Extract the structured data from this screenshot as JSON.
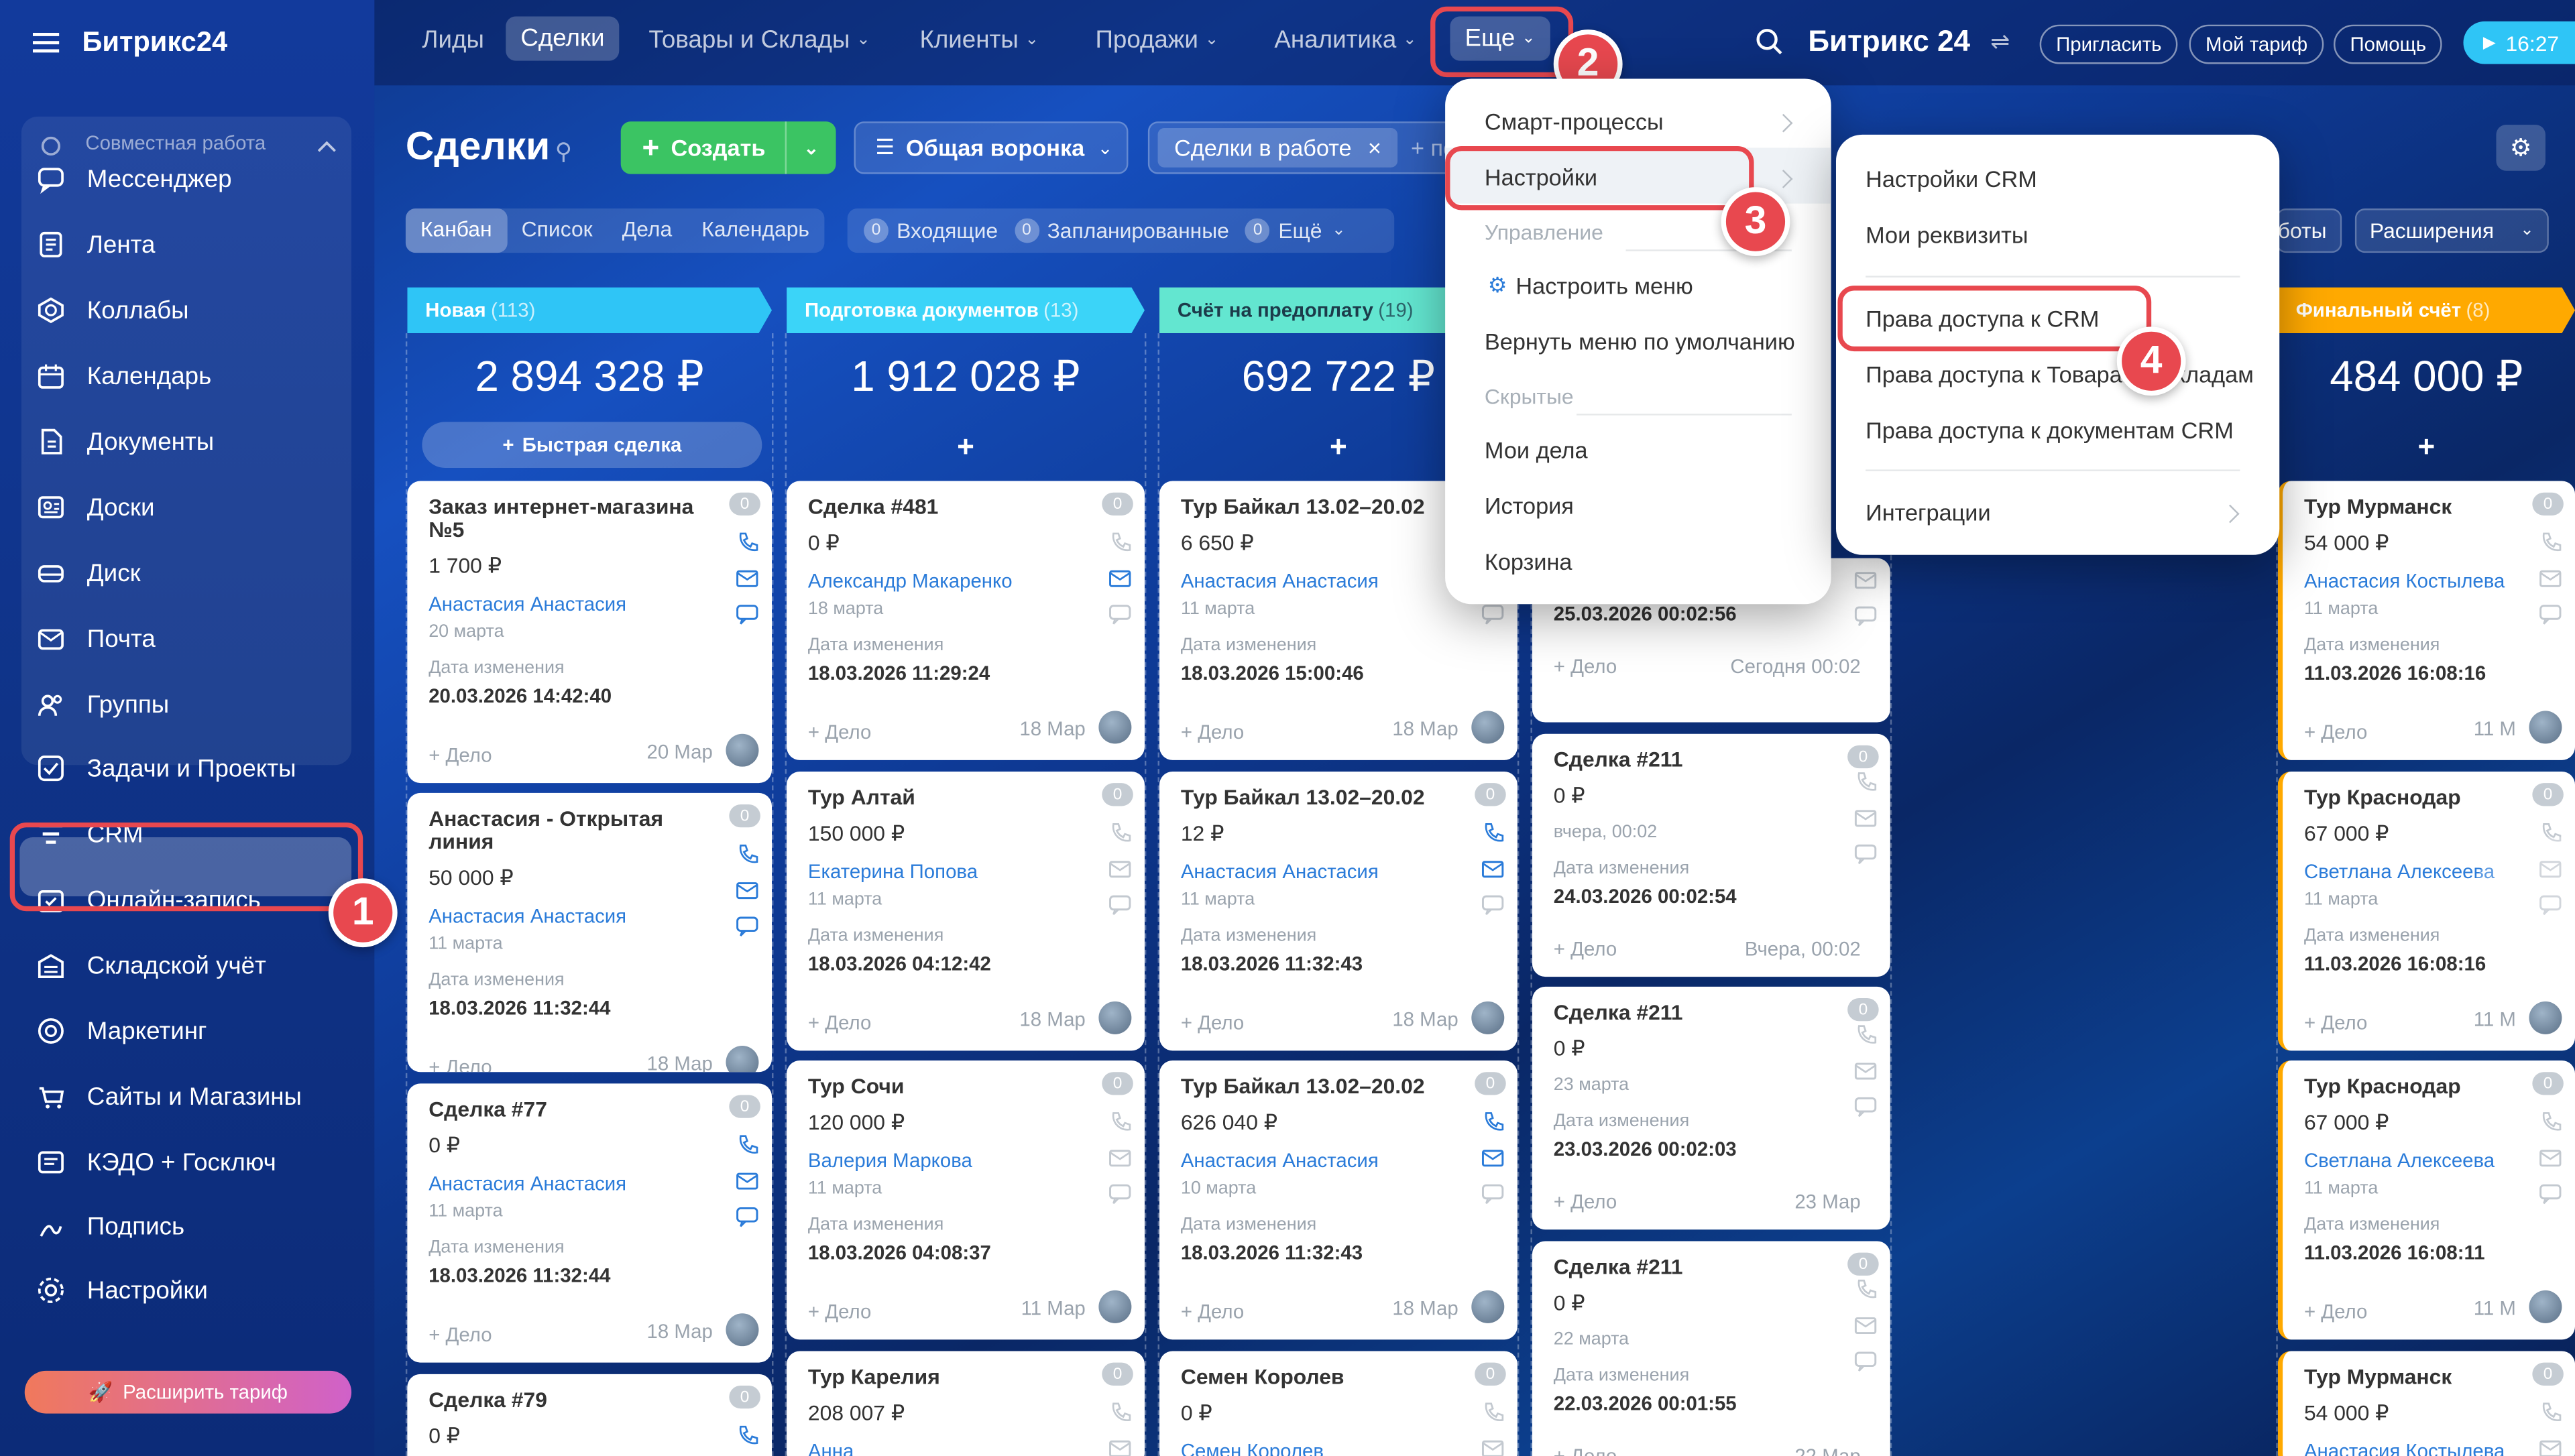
{
  "app": {
    "logo": "Битрикс24",
    "logo_right": "Битрикс 24",
    "time": "16:27"
  },
  "sidebar": {
    "group_title": "Совместная работа",
    "items": [
      {
        "label": "Мессенджер",
        "icon": "messenger-icon"
      },
      {
        "label": "Лента",
        "icon": "feed-icon"
      },
      {
        "label": "Коллабы",
        "icon": "collabs-icon"
      },
      {
        "label": "Календарь",
        "icon": "calendar-icon"
      },
      {
        "label": "Документы",
        "icon": "documents-icon"
      },
      {
        "label": "Доски",
        "icon": "boards-icon"
      },
      {
        "label": "Диск",
        "icon": "disk-icon"
      },
      {
        "label": "Почта",
        "icon": "mail-icon"
      },
      {
        "label": "Группы",
        "icon": "groups-icon"
      },
      {
        "label": "Задачи и Проекты",
        "icon": "tasks-icon"
      },
      {
        "label": "CRM",
        "icon": "crm-icon"
      },
      {
        "label": "Онлайн-запись",
        "icon": "booking-icon"
      },
      {
        "label": "Складской учёт",
        "icon": "warehouse-icon"
      },
      {
        "label": "Маркетинг",
        "icon": "marketing-icon"
      },
      {
        "label": "Сайты и Магазины",
        "icon": "sites-icon"
      },
      {
        "label": "КЭДО + Госключ",
        "icon": "kedo-icon"
      },
      {
        "label": "Подпись",
        "icon": "sign-icon"
      },
      {
        "label": "Настройки",
        "icon": "settings-icon"
      }
    ],
    "expand": "Расширить тариф"
  },
  "topnav": {
    "items": [
      "Лиды",
      "Сделки",
      "Товары и Склады",
      "Клиенты",
      "Продажи",
      "Аналитика",
      "Еще"
    ],
    "invite": "Пригласить",
    "tariff": "Мой тариф",
    "help": "Помощь"
  },
  "toolbar": {
    "title": "Сделки",
    "create": "Создать",
    "funnel": "Общая воронка",
    "filter_tag": "Сделки в работе",
    "filter_more": "+ по"
  },
  "views": [
    "Канбан",
    "Список",
    "Дела",
    "Календарь"
  ],
  "counters": [
    {
      "n": "0",
      "label": "Входящие"
    },
    {
      "n": "0",
      "label": "Запланированные"
    },
    {
      "n": "0",
      "label": "Ещё"
    }
  ],
  "right_buttons": {
    "partial": "боты",
    "extensions": "Расширения"
  },
  "stages": [
    {
      "name": "Новая",
      "count": "(113)",
      "sum": "2 894 328 ₽",
      "color": "#2fc5f6"
    },
    {
      "name": "Подготовка документов",
      "count": "(13)",
      "sum": "1 912 028 ₽",
      "color": "#2fc5f6"
    },
    {
      "name": "Счёт на предоплату",
      "count": "(19)",
      "sum": "692 722 ₽",
      "color": "#5fe0c8"
    },
    {
      "name": "Финальный счёт",
      "count": "(8)",
      "sum": "484 000 ₽",
      "color": "#ffa900"
    }
  ],
  "quick_deal": "Быстрая сделка",
  "columns": [
    [
      {
        "title": "Заказ интернет-магазина №5",
        "price": "1 700 ₽",
        "contact": "Анастасия Анастасия",
        "date": "20 марта",
        "changed_label": "Дата изменения",
        "changed": "20.03.2026 14:42:40",
        "action": "+ Дело",
        "right": "20 Мар"
      },
      {
        "title": "Анастасия - Открытая линия",
        "price": "50 000 ₽",
        "contact": "Анастасия Анастасия",
        "date": "11 марта",
        "changed_label": "Дата изменения",
        "changed": "18.03.2026 11:32:44",
        "action": "+ Дело",
        "right": "18 Мар"
      },
      {
        "title": "Сделка #77",
        "price": "0 ₽",
        "contact": "Анастасия Анастасия",
        "date": "11 марта",
        "changed_label": "Дата изменения",
        "changed": "18.03.2026 11:32:44",
        "action": "+ Дело",
        "right": "18 Мар"
      },
      {
        "title": "Сделка #79",
        "price": "0 ₽"
      }
    ],
    [
      {
        "title": "Сделка #481",
        "price": "0 ₽",
        "contact": "Александр Макаренко",
        "date": "18 марта",
        "changed_label": "Дата изменения",
        "changed": "18.03.2026 11:29:24",
        "action": "+ Дело",
        "right": "18 Мар"
      },
      {
        "title": "Тур Алтай",
        "price": "150 000 ₽",
        "contact": "Екатерина Попова",
        "date": "11 марта",
        "changed_label": "Дата изменения",
        "changed": "18.03.2026 04:12:42",
        "action": "+ Дело",
        "right": "18 Мар"
      },
      {
        "title": "Тур Сочи",
        "price": "120 000 ₽",
        "contact": "Валерия Маркова",
        "date": "11 марта",
        "changed_label": "Дата изменения",
        "changed": "18.03.2026 04:08:37",
        "action": "+ Дело",
        "right": "11 Мар"
      },
      {
        "title": "Тур Карелия",
        "price": "208 007 ₽",
        "contact": "Анна"
      }
    ],
    [
      {
        "title": "Тур Байкал 13.02–20.02",
        "price": "6 650 ₽",
        "contact": "Анастасия Анастасия",
        "date": "11 марта",
        "changed_label": "Дата изменения",
        "changed": "18.03.2026 15:00:46",
        "action": "+ Дело",
        "right": "18 Мар"
      },
      {
        "title": "Тур Байкал 13.02–20.02",
        "price": "12 ₽",
        "contact": "Анастасия Анастасия",
        "date": "11 марта",
        "changed_label": "Дата изменения",
        "changed": "18.03.2026 11:32:43",
        "action": "+ Дело",
        "right": "18 Мар"
      },
      {
        "title": "Тур Байкал 13.02–20.02",
        "price": "626 040 ₽",
        "contact": "Анастасия Анастасия",
        "date": "10 марта",
        "changed_label": "Дата изменения",
        "changed": "18.03.2026 11:32:43",
        "action": "+ Дело",
        "right": "18 Мар"
      },
      {
        "title": "Семен Королев",
        "price": "0 ₽",
        "contact": "Семен Королев"
      }
    ],
    [
      {
        "changed_label": "Дата изменения",
        "changed": "25.03.2026 00:02:56",
        "action": "+ Дело",
        "right": "Сегодня 00:02"
      },
      {
        "title": "Сделка #211",
        "price": "0 ₽",
        "date": "вчера, 00:02",
        "changed_label": "Дата изменения",
        "changed": "24.03.2026 00:02:54",
        "action": "+ Дело",
        "right": "Вчера, 00:02"
      },
      {
        "title": "Сделка #211",
        "price": "0 ₽",
        "date": "23 марта",
        "changed_label": "Дата изменения",
        "changed": "23.03.2026 00:02:03",
        "action": "+ Дело",
        "right": "23 Мар"
      },
      {
        "title": "Сделка #211",
        "price": "0 ₽",
        "date": "22 марта",
        "changed_label": "Дата изменения",
        "changed": "22.03.2026 00:01:55",
        "action": "+ Дело",
        "right": "22 Мар"
      }
    ],
    [
      {
        "title": "Тур Мурманск",
        "price": "54 000 ₽",
        "contact": "Анастасия Костылева",
        "date": "11 марта",
        "changed_label": "Дата изменения",
        "changed": "11.03.2026 16:08:16",
        "action": "+ Дело",
        "right": "11 М"
      },
      {
        "title": "Тур Краснодар",
        "price": "67 000 ₽",
        "contact": "Светлана Алексеева",
        "date": "11 марта",
        "changed_label": "Дата изменения",
        "changed": "11.03.2026 16:08:16",
        "action": "+ Дело",
        "right": "11 М"
      },
      {
        "title": "Тур Краснодар",
        "price": "67 000 ₽",
        "contact": "Светлана Алексеева",
        "date": "11 марта",
        "changed_label": "Дата изменения",
        "changed": "11.03.2026 16:08:11",
        "action": "+ Дело",
        "right": "11 М"
      },
      {
        "title": "Тур Мурманск",
        "price": "54 000 ₽",
        "contact": "Анастасия Костылева"
      }
    ]
  ],
  "more_menu": {
    "items": [
      "Смарт-процессы",
      "Настройки",
      "Управление",
      "Настроить меню",
      "Вернуть меню по умолчанию",
      "Скрытые",
      "Мои дела",
      "История",
      "Корзина"
    ]
  },
  "settings_menu": {
    "items": [
      "Настройки CRM",
      "Мои реквизиты",
      "Права доступа к CRM",
      "Права доступа к Товарам и складам",
      "Права доступа к документам CRM",
      "Интеграции"
    ]
  },
  "annotations": [
    "1",
    "2",
    "3",
    "4"
  ],
  "colors": {
    "accent_red": "#e8484f",
    "create_green": "#3bc463",
    "link_blue": "#2a7bd9"
  }
}
